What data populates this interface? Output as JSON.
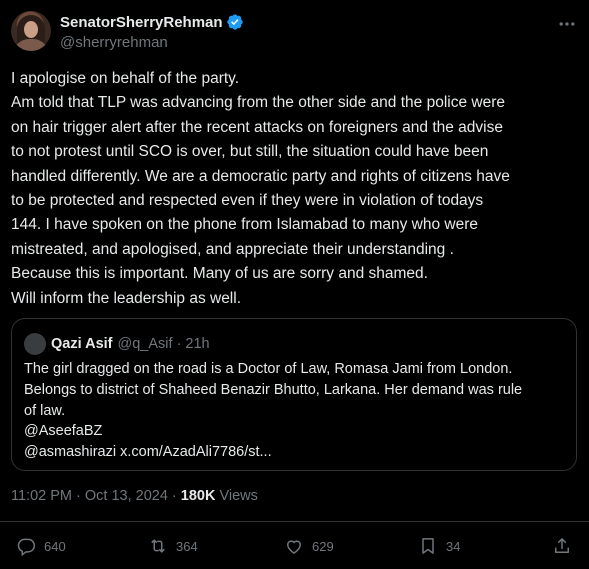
{
  "author": {
    "display_name": "SenatorSherryRehman",
    "handle": "@sherryrehman",
    "verified_color": "#1d9bf0"
  },
  "body_lines": [
    "I apologise on behalf of the party.",
    "Am told that TLP was advancing from the other side and the police were",
    "on hair trigger alert after the recent attacks on foreigners and the advise",
    "to not protest until SCO is over, but still, the situation could have been",
    "handled differently. We are a democratic party and rights of citizens have",
    "to be protected and respected even if they were in violation of todays",
    "144. I have spoken on the phone from Islamabad to many who were",
    "mistreated, and apologised, and appreciate their understanding .",
    "Because this is important. Many of us are sorry and shamed.",
    "Will inform the leadership as well."
  ],
  "quote": {
    "name": "Qazi Asif",
    "meta": "@q_Asif · 21h",
    "lines": [
      "The girl dragged on the road is a Doctor of Law, Romasa Jami from London.",
      "Belongs to district of Shaheed Benazir Bhutto, Larkana. Her demand was rule",
      "of law.",
      "@AseefaBZ",
      "@asmashirazi x.com/AzadAli7786/st..."
    ]
  },
  "meta": {
    "timestamp": "11:02 PM · Oct 13, 2024 ·",
    "views_count": "180K",
    "views_label": "Views"
  },
  "actions": {
    "replies": "640",
    "reposts": "364",
    "likes": "629",
    "bookmarks": "34"
  },
  "icons": {
    "more": "more-icon",
    "reply": "reply-icon",
    "repost": "repost-icon",
    "like": "like-icon",
    "bookmark": "bookmark-icon",
    "share": "share-icon"
  },
  "colors": {
    "background": "#000000",
    "text": "#e7e9ea",
    "muted": "#71767b",
    "border": "#2f3336"
  }
}
